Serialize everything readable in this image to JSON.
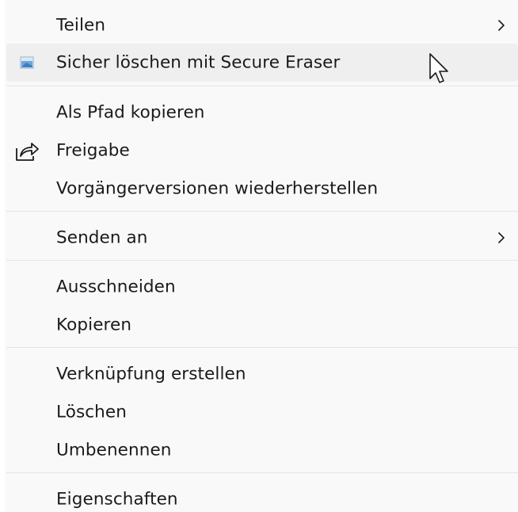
{
  "menu": {
    "items": [
      {
        "label": "Teilen",
        "icon": null,
        "submenu": true
      },
      {
        "label": "Sicher löschen mit Secure Eraser",
        "icon": "secure-eraser-icon",
        "submenu": false,
        "highlighted": true
      },
      {
        "label": "Als Pfad kopieren",
        "icon": null,
        "submenu": false
      },
      {
        "label": "Freigabe",
        "icon": "share-icon",
        "submenu": false
      },
      {
        "label": "Vorgängerversionen wiederherstellen",
        "icon": null,
        "submenu": false
      },
      {
        "label": "Senden an",
        "icon": null,
        "submenu": true
      },
      {
        "label": "Ausschneiden",
        "icon": null,
        "submenu": false
      },
      {
        "label": "Kopieren",
        "icon": null,
        "submenu": false
      },
      {
        "label": "Verknüpfung erstellen",
        "icon": null,
        "submenu": false
      },
      {
        "label": "Löschen",
        "icon": null,
        "submenu": false
      },
      {
        "label": "Umbenennen",
        "icon": null,
        "submenu": false
      },
      {
        "label": "Eigenschaften",
        "icon": null,
        "submenu": false
      }
    ]
  },
  "colors": {
    "menu_background": "#f9f9f9",
    "highlight_background": "#efefef",
    "separator": "#e4e4e4",
    "text": "#1a1a1a"
  }
}
